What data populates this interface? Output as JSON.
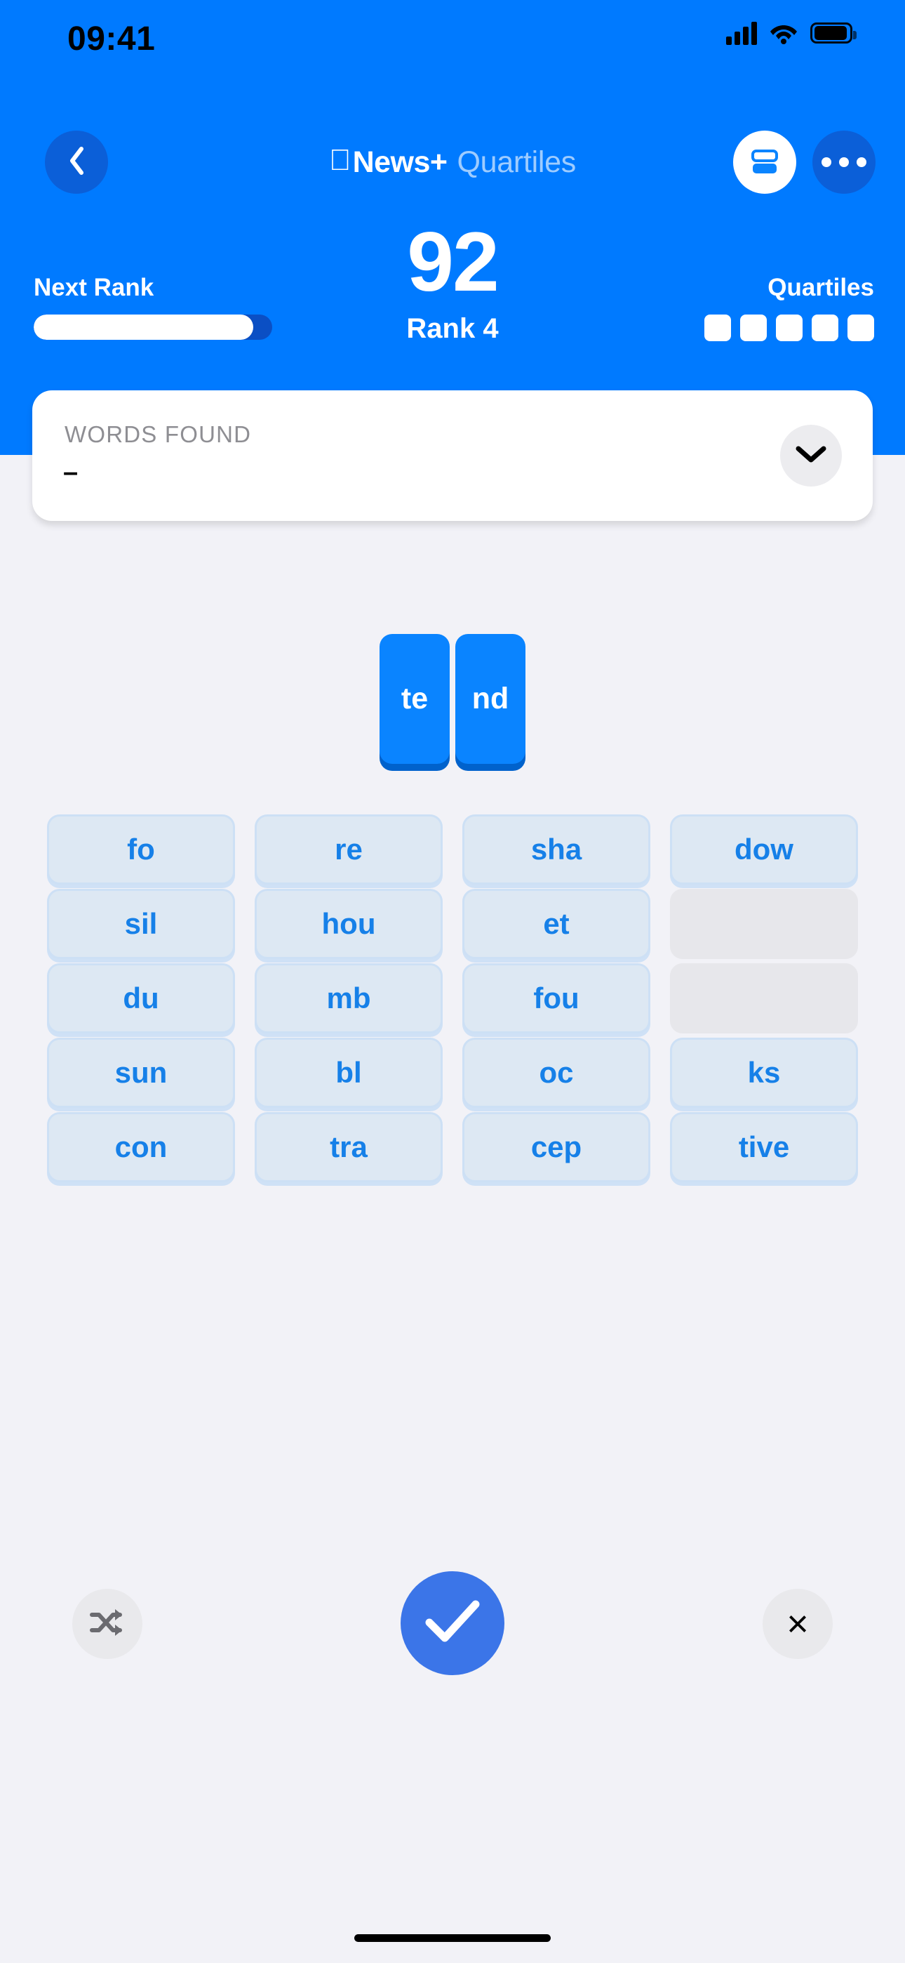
{
  "status_bar": {
    "time": "09:41",
    "cellular_icon": "cellular-bars-icon",
    "wifi_icon": "wifi-icon",
    "battery_icon": "battery-full-icon"
  },
  "nav": {
    "back_icon": "chevron-left-icon",
    "apple_glyph": "",
    "title_brand": "News+",
    "title_game": "Quartiles",
    "cards_icon": "stacked-cards-icon",
    "more_icon": "ellipsis-icon"
  },
  "score": {
    "value": "92",
    "rank_label": "Rank 4",
    "next_rank_label": "Next Rank",
    "progress_percent": 92,
    "quartiles_label": "Quartiles",
    "quartiles_slots": [
      true,
      true,
      true,
      true,
      true
    ]
  },
  "words_found": {
    "label": "WORDS FOUND",
    "value": "–",
    "expand_icon": "chevron-down-icon"
  },
  "selection": {
    "tiles": [
      "te",
      "nd"
    ]
  },
  "grid": {
    "rows": [
      [
        {
          "label": "fo",
          "empty": false
        },
        {
          "label": "re",
          "empty": false
        },
        {
          "label": "sha",
          "empty": false
        },
        {
          "label": "dow",
          "empty": false
        }
      ],
      [
        {
          "label": "sil",
          "empty": false
        },
        {
          "label": "hou",
          "empty": false
        },
        {
          "label": "et",
          "empty": false
        },
        {
          "label": "",
          "empty": true
        }
      ],
      [
        {
          "label": "du",
          "empty": false
        },
        {
          "label": "mb",
          "empty": false
        },
        {
          "label": "fou",
          "empty": false
        },
        {
          "label": "",
          "empty": true
        }
      ],
      [
        {
          "label": "sun",
          "empty": false
        },
        {
          "label": "bl",
          "empty": false
        },
        {
          "label": "oc",
          "empty": false
        },
        {
          "label": "ks",
          "empty": false
        }
      ],
      [
        {
          "label": "con",
          "empty": false
        },
        {
          "label": "tra",
          "empty": false
        },
        {
          "label": "cep",
          "empty": false
        },
        {
          "label": "tive",
          "empty": false
        }
      ]
    ]
  },
  "controls": {
    "shuffle_icon": "shuffle-icon",
    "submit_icon": "checkmark-icon",
    "clear_icon": "close-x-icon",
    "clear_glyph": "×"
  },
  "colors": {
    "header_blue": "#007aff",
    "tile_blue": "#0a84ff",
    "tile_blue_shadow": "#0062cc",
    "tile_bg": "#dde8f3",
    "tile_border": "#cde0f5",
    "tile_text": "#1680e8",
    "submit_blue": "#3b75e8",
    "page_bg": "#f2f2f7"
  }
}
